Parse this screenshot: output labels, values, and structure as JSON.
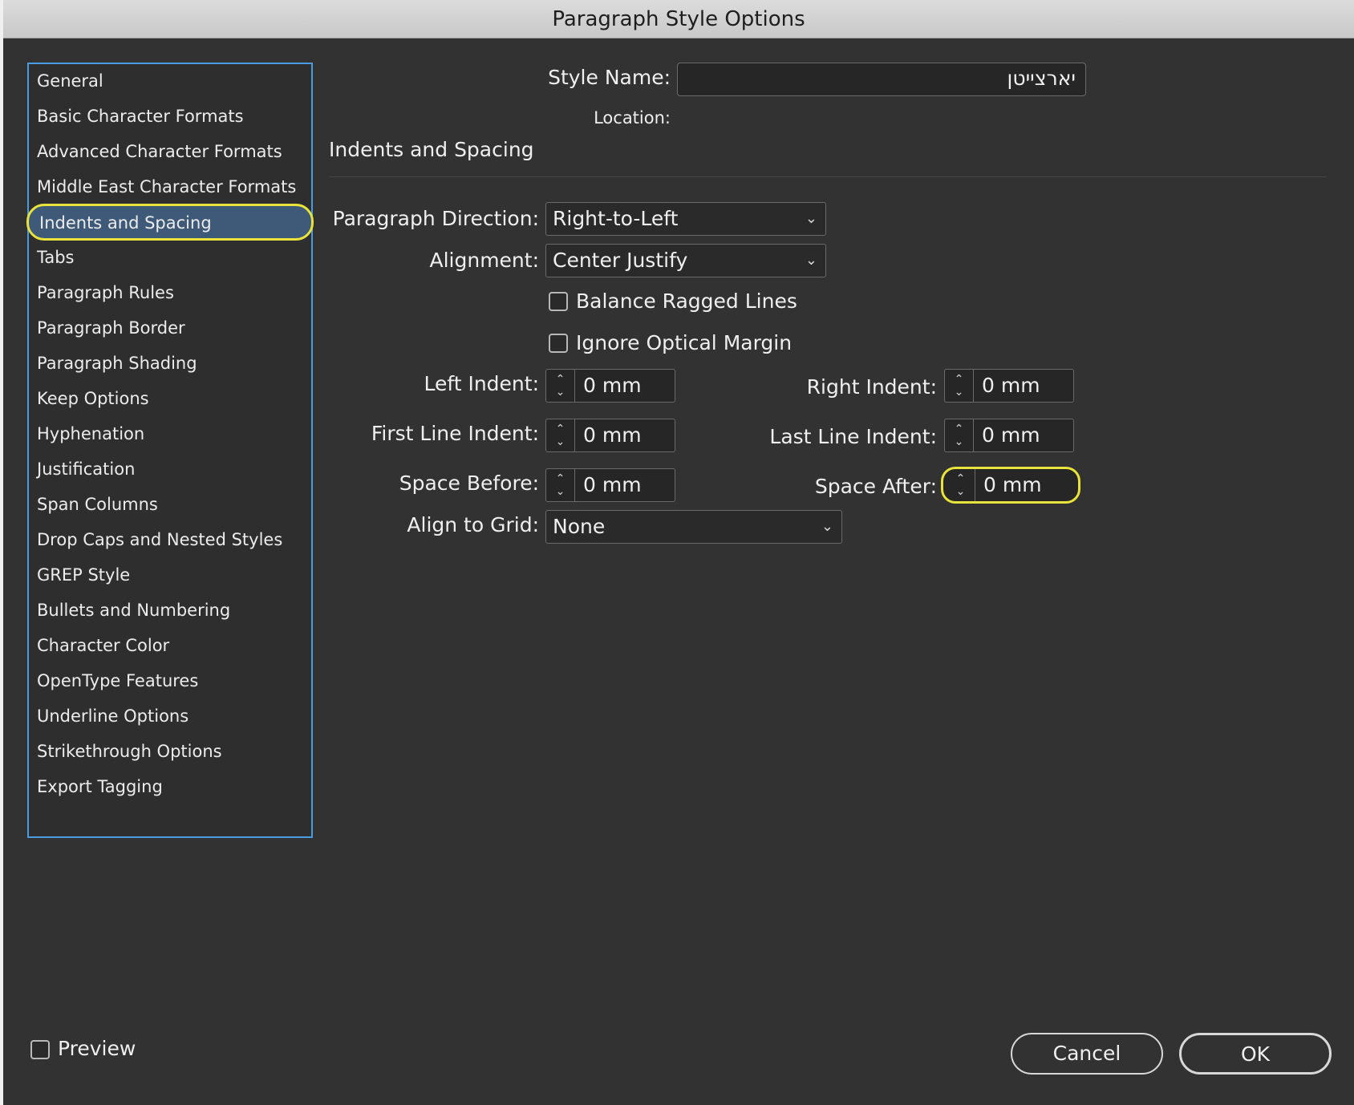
{
  "window": {
    "title": "Paragraph Style Options"
  },
  "sidebar": {
    "items": [
      {
        "label": "General"
      },
      {
        "label": "Basic Character Formats"
      },
      {
        "label": "Advanced Character Formats"
      },
      {
        "label": "Middle East Character Formats"
      },
      {
        "label": "Indents and Spacing",
        "selected": true
      },
      {
        "label": "Tabs"
      },
      {
        "label": "Paragraph Rules"
      },
      {
        "label": "Paragraph Border"
      },
      {
        "label": "Paragraph Shading"
      },
      {
        "label": "Keep Options"
      },
      {
        "label": "Hyphenation"
      },
      {
        "label": "Justification"
      },
      {
        "label": "Span Columns"
      },
      {
        "label": "Drop Caps and Nested Styles"
      },
      {
        "label": "GREP Style"
      },
      {
        "label": "Bullets and Numbering"
      },
      {
        "label": "Character Color"
      },
      {
        "label": "OpenType Features"
      },
      {
        "label": "Underline Options"
      },
      {
        "label": "Strikethrough Options"
      },
      {
        "label": "Export Tagging"
      }
    ]
  },
  "header": {
    "style_name_label": "Style Name:",
    "style_name_value": "יארצייטן",
    "location_label": "Location:"
  },
  "section": {
    "title": "Indents and Spacing",
    "paragraph_direction": {
      "label": "Paragraph Direction:",
      "value": "Right-to-Left"
    },
    "alignment": {
      "label": "Alignment:",
      "value": "Center Justify"
    },
    "balance_ragged_lines": {
      "label": "Balance Ragged Lines",
      "checked": false
    },
    "ignore_optical_margin": {
      "label": "Ignore Optical Margin",
      "checked": false
    },
    "left_indent": {
      "label": "Left Indent:",
      "value": "0 mm"
    },
    "right_indent": {
      "label": "Right Indent:",
      "value": "0 mm"
    },
    "first_line_indent": {
      "label": "First Line Indent:",
      "value": "0 mm"
    },
    "last_line_indent": {
      "label": "Last Line Indent:",
      "value": "0 mm"
    },
    "space_before": {
      "label": "Space Before:",
      "value": "0 mm"
    },
    "space_after": {
      "label": "Space After:",
      "value": "0 mm"
    },
    "align_to_grid": {
      "label": "Align to Grid:",
      "value": "None"
    }
  },
  "footer": {
    "preview_label": "Preview",
    "preview_checked": false,
    "cancel_label": "Cancel",
    "ok_label": "OK"
  },
  "colors": {
    "background": "#323232",
    "accent_border": "#4a9be0",
    "selection": "#3e5a78",
    "highlight": "#e8e23a"
  }
}
